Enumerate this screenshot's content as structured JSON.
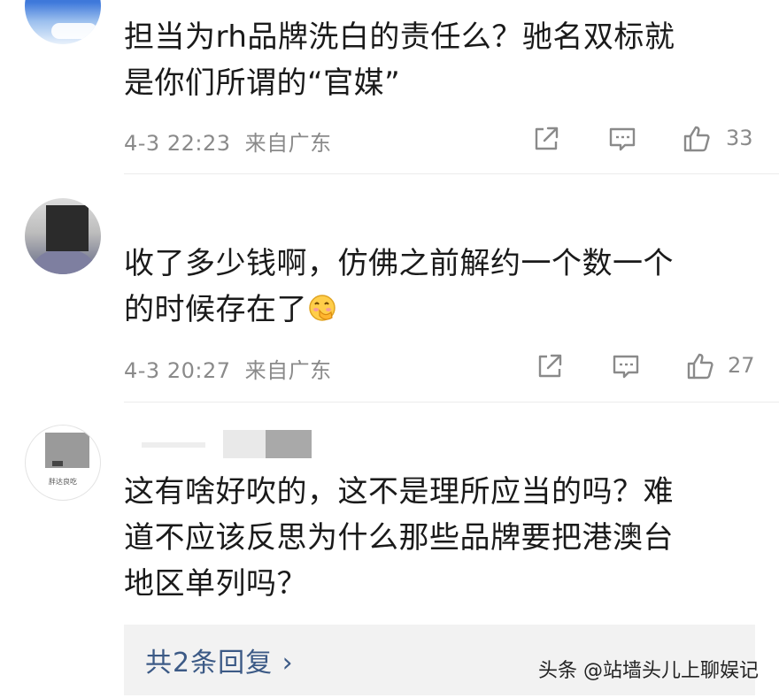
{
  "comments": [
    {
      "text": "担当为rh品牌洗白的责任么？驰名双标就\n是你们所谓的“官媒”",
      "date": "4-3 22:23",
      "location": "来自广东",
      "likes": "33"
    },
    {
      "text": "收了多少钱啊，仿佛之前解约一个数一个\n的时候存在了",
      "emoji": "face-with-hand-over-mouth",
      "date": "4-3 20:27",
      "location": "来自广东",
      "likes": "27"
    },
    {
      "avatar_text": "胖达良吃",
      "text": "这有啥好吹的，这不是理所应当的吗？难\n道不应该反思为什么那些品牌要把港澳台\n地区单列吗？",
      "replies_label": "共2条回复 ›"
    }
  ],
  "watermark": "头条 @站墙头儿上聊娱记",
  "icons": [
    "share-icon",
    "comment-icon",
    "like-icon"
  ],
  "colors": {
    "text": "#1a1a1a",
    "meta": "#8a8a8a",
    "link": "#3c5a86",
    "reply_bg": "#f2f2f2"
  }
}
